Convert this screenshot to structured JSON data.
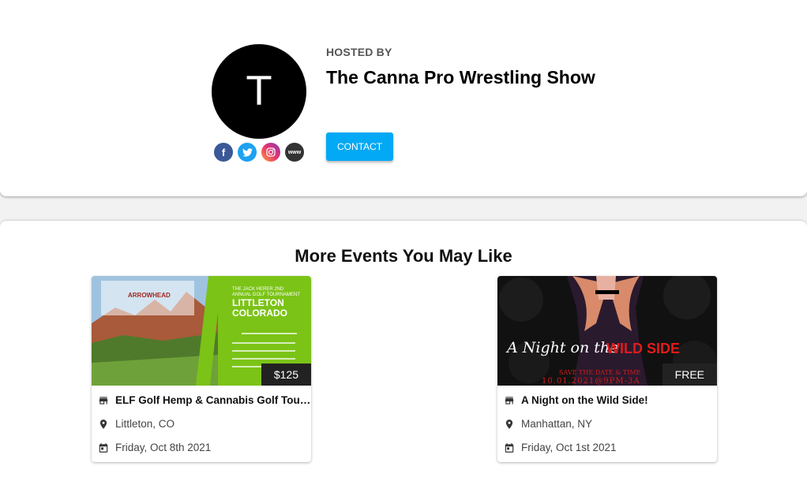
{
  "host": {
    "avatar_letter": "T",
    "hosted_by_label": "HOSTED BY",
    "name": "The Canna Pro Wrestling Show",
    "contact_label": "CONTACT",
    "socials": {
      "facebook": "f",
      "www": "www"
    }
  },
  "section": {
    "title": "More Events You May Like"
  },
  "events": [
    {
      "title": "ELF Golf Hemp & Cannabis Golf Tourn...",
      "location": "Littleton, CO",
      "date": "Friday, Oct 8th 2021",
      "price": "$125",
      "image": {
        "logo_text": "ARROWHEAD",
        "heading_small": "THE JACK HERER 2ND ANNUAL GOLF TOURNAMENT",
        "heading_big": "LITTLETON COLORADO"
      }
    },
    {
      "title": "A Night on the Wild Side!",
      "location": "Manhattan, NY",
      "date": "Friday, Oct 1st 2021",
      "price": "FREE",
      "image": {
        "script_text": "A Night on the",
        "bold_text": "WILD SIDE",
        "save_text": "SAVE THE DATE & TIME",
        "date_text": "10.01.2021@9PM-3A"
      }
    }
  ],
  "colors": {
    "accent": "#03a9f4",
    "facebook": "#3b5998",
    "twitter": "#1da1f2"
  }
}
